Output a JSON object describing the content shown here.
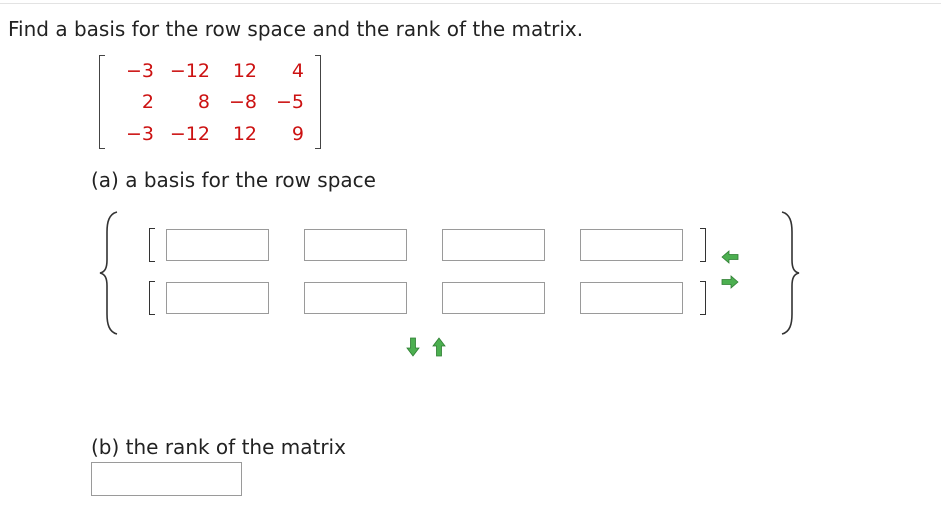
{
  "question": "Find a basis for the row space and the rank of the matrix.",
  "matrix": {
    "rows": [
      [
        "−3",
        "−12",
        "12",
        "4"
      ],
      [
        "2",
        "8",
        "−8",
        "−5"
      ],
      [
        "−3",
        "−12",
        "12",
        "9"
      ]
    ],
    "entry_color": "#cc1111"
  },
  "part_a": {
    "label": "(a) a basis for the row space"
  },
  "part_b": {
    "label": "(b) the rank of the matrix"
  },
  "basis_rows": [
    {
      "values": [
        "",
        "",
        "",
        ""
      ]
    },
    {
      "values": [
        "",
        "",
        "",
        ""
      ]
    }
  ],
  "rank_value": "",
  "icons": {
    "row_remove": "arrow-left-icon",
    "row_add": "arrow-right-icon",
    "vector_add": "arrow-down-icon",
    "vector_remove": "arrow-up-icon"
  },
  "arrow_color": "#4caf50"
}
